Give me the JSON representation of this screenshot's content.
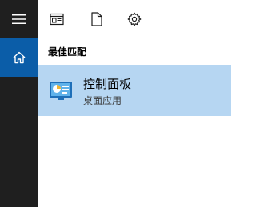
{
  "rail": {
    "menu_icon": "hamburger-menu-icon",
    "home_icon": "home-icon",
    "active_item": "home"
  },
  "topbar": {
    "icons": [
      "apps-icon",
      "document-icon",
      "settings-gear-icon"
    ]
  },
  "results": {
    "heading": "最佳匹配",
    "best_match": {
      "title": "控制面板",
      "subtitle": "桌面应用",
      "icon": "control-panel-icon"
    }
  },
  "colors": {
    "rail_background": "#1f1f1f",
    "rail_active": "#0b5da8",
    "result_highlight": "#b6d6f2"
  }
}
